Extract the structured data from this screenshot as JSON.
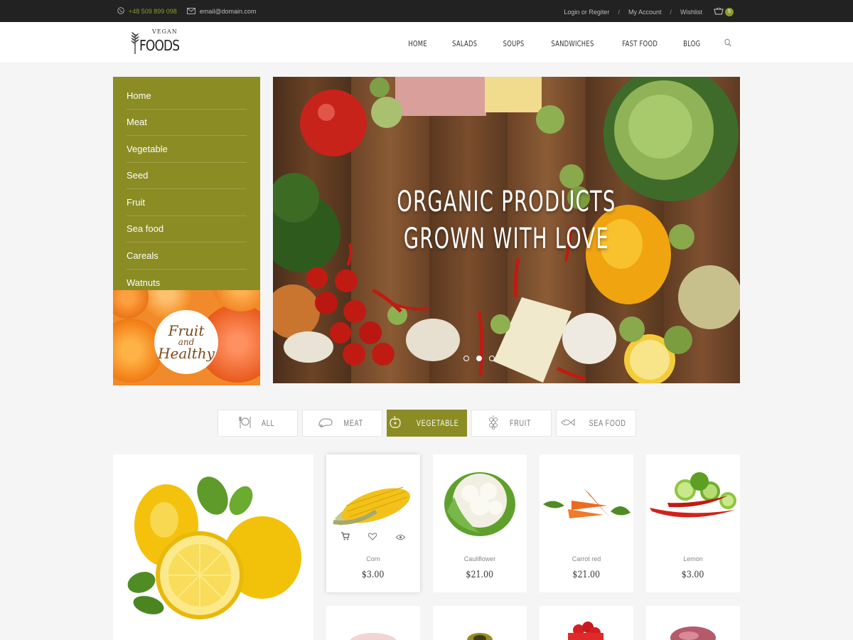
{
  "topbar": {
    "phone": "+48 509 899 098",
    "email": "email@domain.com",
    "login": "Login or Regiter",
    "sep1": "/",
    "account": "My Account",
    "sep2": "/",
    "wishlist": "Wishlist",
    "cart_count": "5"
  },
  "logo": {
    "small": "VEGAN",
    "big": "FOODS"
  },
  "nav": [
    "HOME",
    "SALADS",
    "SOUPS",
    "SANDWICHES",
    "FAST FOOD",
    "BLOG"
  ],
  "sidebar": {
    "items": [
      "Home",
      "Meat",
      "Vegetable",
      "Seed",
      "Fruit",
      "Sea food",
      "Careals",
      "Watnuts"
    ]
  },
  "promo": {
    "line1": "Fruit",
    "line2": "and",
    "line3": "Healthy"
  },
  "hero": {
    "line1": "ORGANIC PRODUCTS",
    "line2": "GROWN WITH LOVE",
    "active_slide": 2,
    "slide_count": 3
  },
  "tabs": [
    {
      "label": "ALL",
      "icon": "fork-knife-icon",
      "active": false
    },
    {
      "label": "MEAT",
      "icon": "chicken-leg-icon",
      "active": false
    },
    {
      "label": "VEGETABLE",
      "icon": "apple-icon",
      "active": true
    },
    {
      "label": "FRUIT",
      "icon": "grapes-icon",
      "active": false
    },
    {
      "label": "SEA FOOD",
      "icon": "fish-icon",
      "active": false
    }
  ],
  "products": [
    {
      "name": "Corn",
      "price": "$3.00"
    },
    {
      "name": "Cauliflower",
      "price": "$21.00"
    },
    {
      "name": "Carrot red",
      "price": "$21.00"
    },
    {
      "name": "Lemon",
      "price": "$3.00"
    }
  ],
  "colors": {
    "accent": "#8b8c24",
    "topbar": "#222222",
    "background": "#f5f5f5"
  }
}
